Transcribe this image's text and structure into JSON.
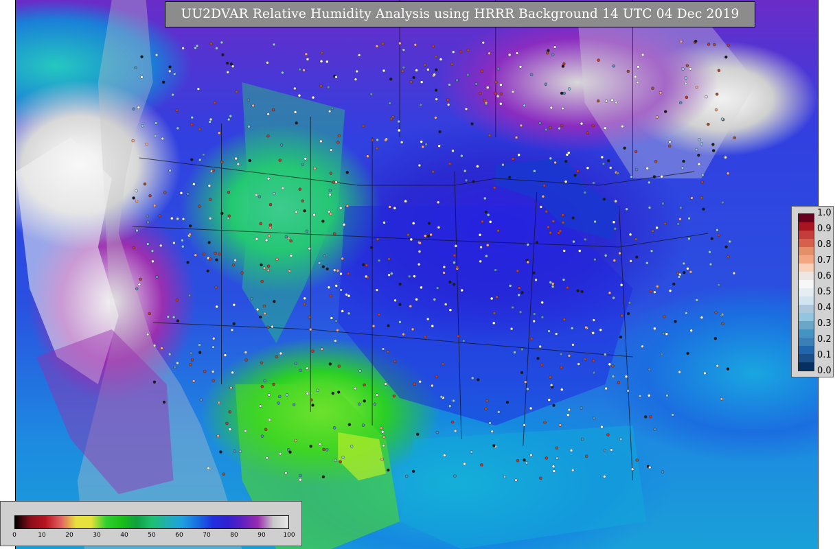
{
  "title": "UU2DVAR Relative Humidity Analysis using HRRR Background 14 UTC 04 Dec 2019",
  "colorbar_rh": {
    "ticks": [
      "0",
      "10",
      "20",
      "30",
      "40",
      "50",
      "60",
      "70",
      "80",
      "90",
      "100"
    ],
    "colors": [
      "#000000",
      "#8b0d1a",
      "#b8141e",
      "#e06060",
      "#e8e040",
      "#e6e23a",
      "#30d030",
      "#18c018",
      "#10a040",
      "#1ec070",
      "#20b0b0",
      "#1fa0e0",
      "#1870e0",
      "#2030e0",
      "#3020d0",
      "#6020c0",
      "#9a2cb0",
      "#c8c8c8",
      "#e8e8e8"
    ]
  },
  "colorbar_obs": {
    "ticks": [
      "1.0",
      "0.9",
      "0.8",
      "0.7",
      "0.6",
      "0.5",
      "0.4",
      "0.3",
      "0.2",
      "0.1",
      "0.0"
    ],
    "colors": [
      "#67001f",
      "#a8141f",
      "#c43c3c",
      "#d6604d",
      "#e58f6a",
      "#f4a582",
      "#fbd0b9",
      "#ede6e2",
      "#f7f7f7",
      "#e6eef3",
      "#d1e5f0",
      "#acc8da",
      "#92c5de",
      "#6ba5c8",
      "#4393c3",
      "#3a7fb5",
      "#2166ac",
      "#1a4f8a",
      "#053061"
    ]
  },
  "station_colors": [
    "#ffffff",
    "#e0e0e0",
    "#c0392b",
    "#a0522d",
    "#f4a582",
    "#5b8fb9",
    "#92c5de",
    "#1a1a1a"
  ]
}
